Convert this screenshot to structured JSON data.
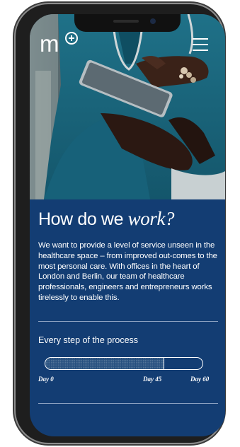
{
  "hero": {
    "image": "doctor-holding-tablet-photo"
  },
  "header": {
    "logo_text": "m",
    "logo_badge_icon": "plus-circle-icon",
    "menu_icon": "hamburger-menu-icon"
  },
  "main": {
    "headline_plain": "How do we ",
    "headline_emphasis": "work?",
    "body": "We want to provide a level of service unseen in the healthcare space – from improved out-comes to the most personal care. With offices in the heart of London and Berlin, our team of healthcare professionals, engineers and entrepreneurs works tirelessly to enable this."
  },
  "process": {
    "title": "Every step of the process",
    "progress_fraction": 0.75,
    "labels": {
      "start": "Day 0",
      "current": "Day 45",
      "end": "Day 60"
    }
  },
  "colors": {
    "background_blue": "#133d73",
    "text": "#ffffff",
    "device_frame": "#1e1e1e"
  }
}
